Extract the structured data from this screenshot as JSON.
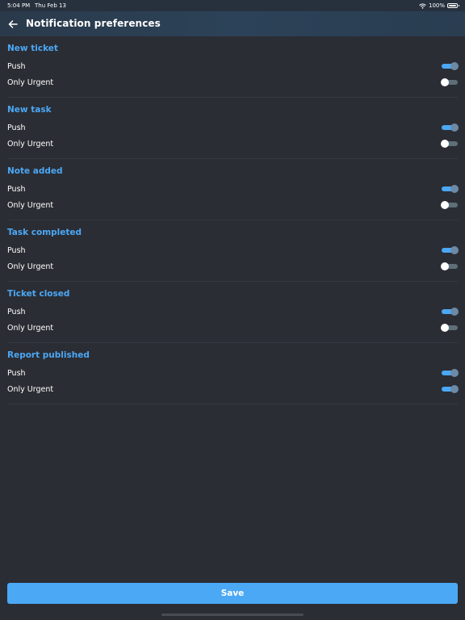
{
  "status_bar": {
    "time": "5:04 PM",
    "date": "Thu Feb 13",
    "battery": "100%"
  },
  "header": {
    "title": "Notification preferences",
    "back_icon": "arrow-left-icon"
  },
  "labels": {
    "push": "Push",
    "urgent": "Only Urgent"
  },
  "sections": [
    {
      "title": "New ticket",
      "push": true,
      "only_urgent": false
    },
    {
      "title": "New task",
      "push": true,
      "only_urgent": false
    },
    {
      "title": "Note added",
      "push": true,
      "only_urgent": false
    },
    {
      "title": "Task completed",
      "push": true,
      "only_urgent": false
    },
    {
      "title": "Ticket closed",
      "push": true,
      "only_urgent": false
    },
    {
      "title": "Report published",
      "push": true,
      "only_urgent": true
    }
  ],
  "footer": {
    "save_label": "Save"
  },
  "colors": {
    "accent": "#4ba8f5",
    "background": "#2b2d34",
    "header": "#2c4258"
  }
}
